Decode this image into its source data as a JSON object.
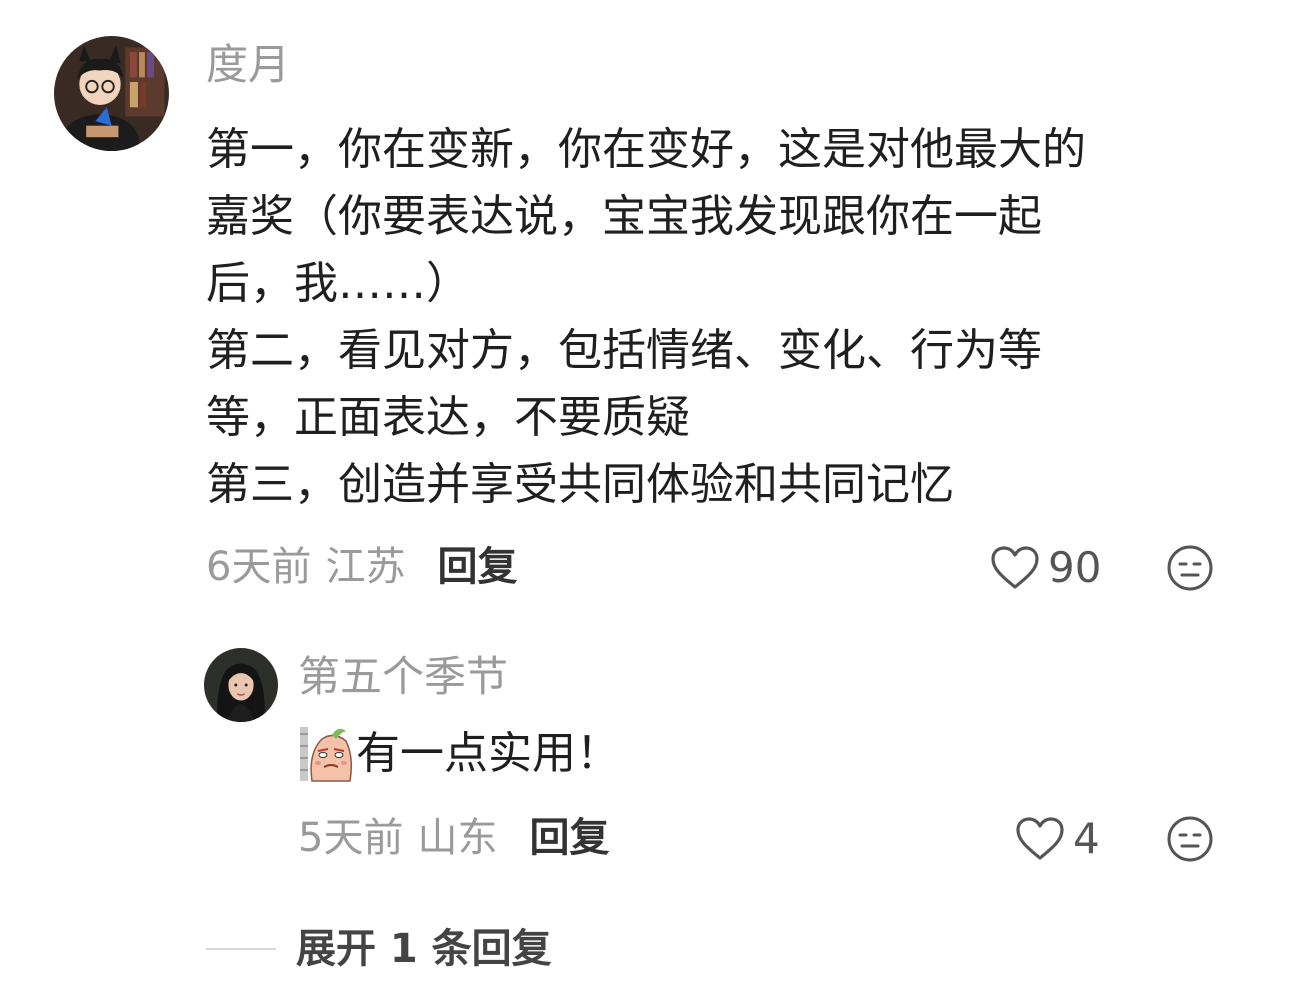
{
  "main_comment": {
    "avatar_icon": "cartoon-boy-avatar-icon",
    "username": "度月",
    "lines": [
      "第一，你在变新，你在变好，这是对他最大的",
      "嘉奖（你要表达说，宝宝我发现跟你在一起",
      "后，我……）",
      "第二，看见对方，包括情绪、变化、行为等",
      "等，正面表达，不要质疑",
      "第三，创造并享受共同体验和共同记忆"
    ],
    "time": "6天前",
    "region": "江苏",
    "reply_label": "回复",
    "like_icon": "heart-outline-icon",
    "like_count": "90",
    "dislike_icon": "neutral-face-icon"
  },
  "reply_comment": {
    "avatar_icon": "woman-portrait-avatar-icon",
    "username": "第五个季节",
    "sticker_icon": "peach-sticker-emoji",
    "text": "有一点实用！",
    "time": "5天前",
    "region": "山东",
    "reply_label": "回复",
    "like_icon": "heart-outline-icon",
    "like_count": "4",
    "dislike_icon": "neutral-face-icon"
  },
  "expand": {
    "label": "展开 1 条回复"
  },
  "colors": {
    "secondary_text": "#9a9a9a",
    "primary_text": "#1f1f1f",
    "icon": "#555555"
  }
}
